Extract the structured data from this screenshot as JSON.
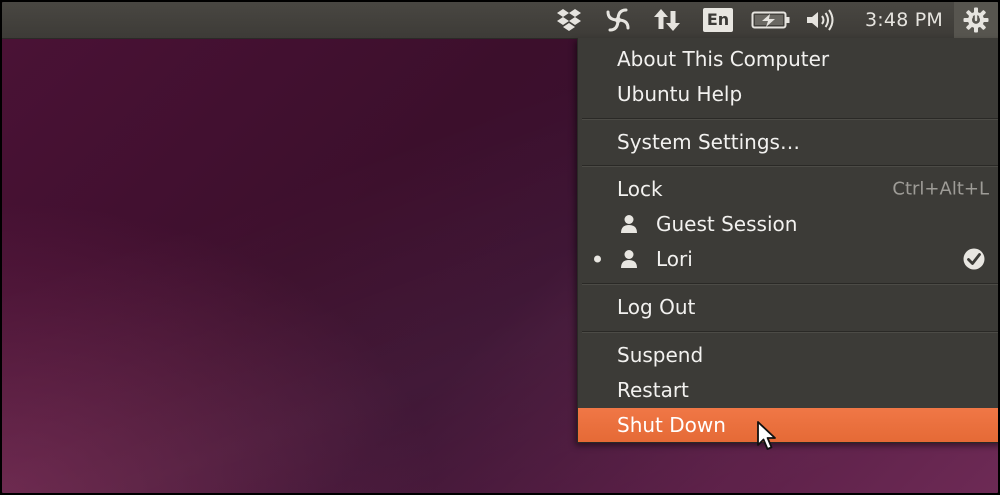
{
  "panel": {
    "keyboard_layout": "En",
    "clock": "3:48 PM",
    "icons": [
      "dropbox-icon",
      "spiral-icon",
      "network-icon",
      "keyboard-layout-indicator",
      "battery-icon",
      "sound-icon",
      "session-gear-icon"
    ]
  },
  "menu": {
    "about": "About This Computer",
    "help": "Ubuntu Help",
    "settings": "System Settings…",
    "lock": "Lock",
    "lock_shortcut": "Ctrl+Alt+L",
    "guest": "Guest Session",
    "user": "Lori",
    "logout": "Log Out",
    "suspend": "Suspend",
    "restart": "Restart",
    "shutdown": "Shut Down"
  },
  "colors": {
    "panel": "#3d3b37",
    "menu_background": "#3c3b37",
    "highlight": "#e9703c",
    "wallpaper": "#3c0f2c"
  }
}
